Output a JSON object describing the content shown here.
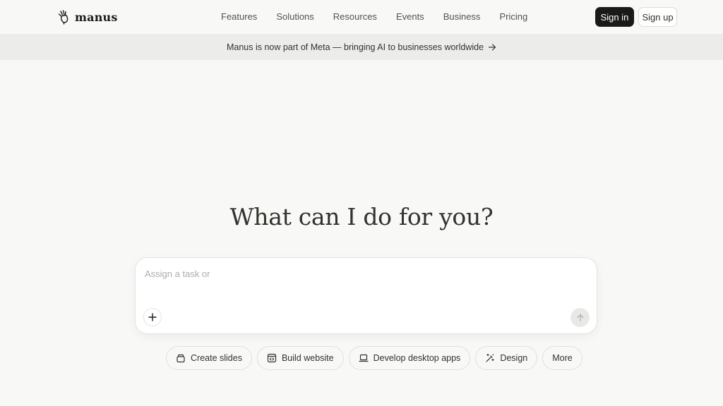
{
  "brand": {
    "name": "manus",
    "logo_icon": "manus-hand-icon"
  },
  "nav": {
    "items": [
      {
        "id": "features",
        "label": "Features"
      },
      {
        "id": "solutions",
        "label": "Solutions"
      },
      {
        "id": "resources",
        "label": "Resources"
      },
      {
        "id": "events",
        "label": "Events"
      },
      {
        "id": "business",
        "label": "Business"
      },
      {
        "id": "pricing",
        "label": "Pricing"
      }
    ],
    "sign_in": "Sign in",
    "sign_up": "Sign up"
  },
  "banner": {
    "text": "Manus is now part of Meta — bringing AI to businesses worldwide",
    "icon": "arrow-right-icon"
  },
  "hero": {
    "title": "What can I do for you?"
  },
  "composer": {
    "placeholder": "Assign a task or",
    "value": "",
    "add_icon": "plus-icon",
    "send_icon": "arrow-up-icon"
  },
  "quick_actions": [
    {
      "label": "Create slides",
      "icon": "slides-icon"
    },
    {
      "label": "Build website",
      "icon": "code-window-icon"
    },
    {
      "label": "Develop desktop apps",
      "icon": "laptop-icon"
    },
    {
      "label": "Design",
      "icon": "magic-wand-icon"
    },
    {
      "label": "More",
      "icon": ""
    }
  ],
  "colors": {
    "background": "#f8f8f7",
    "banner_background": "#ececea",
    "primary_button": "#1a1a19",
    "text": "#34322d",
    "muted_text": "#535350",
    "placeholder": "#acaca8"
  }
}
